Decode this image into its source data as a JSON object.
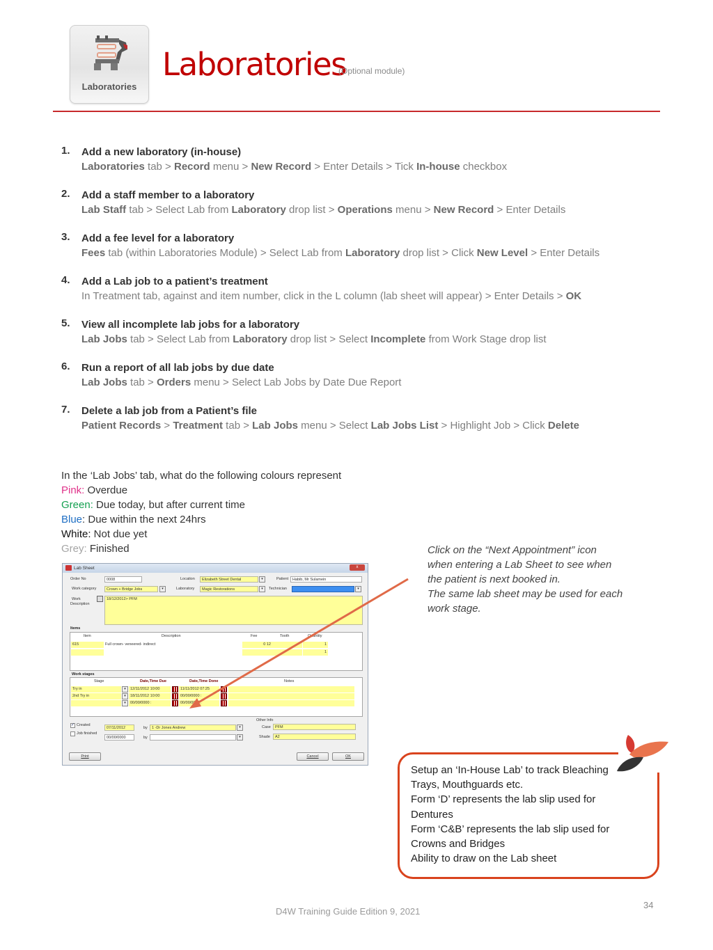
{
  "header": {
    "logo_label": "Laboratories",
    "title": "Laboratories",
    "subtitle": "(Optional module)",
    "accent_color": "#c00000"
  },
  "steps": [
    {
      "num": "1.",
      "title": "Add a new laboratory (in-house)",
      "path": [
        {
          "b": "Laboratories"
        },
        {
          "t": " tab > "
        },
        {
          "b": "Record"
        },
        {
          "t": " menu > "
        },
        {
          "b": "New Record"
        },
        {
          "t": " > Enter Details > Tick "
        },
        {
          "b": "In-house"
        },
        {
          "t": " checkbox"
        }
      ]
    },
    {
      "num": "2.",
      "title": "Add a staff member to a laboratory",
      "path": [
        {
          "b": "Lab Staff"
        },
        {
          "t": " tab > Select Lab from "
        },
        {
          "b": "Laboratory"
        },
        {
          "t": " drop list > "
        },
        {
          "b": "Operations"
        },
        {
          "t": " menu > "
        },
        {
          "b": "New Record"
        },
        {
          "t": " > Enter Details"
        }
      ]
    },
    {
      "num": "3.",
      "title": "Add a fee level for a laboratory",
      "path": [
        {
          "b": "Fees"
        },
        {
          "t": " tab (within Laboratories Module) > Select Lab from "
        },
        {
          "b": "Laboratory"
        },
        {
          "t": " drop list > Click "
        },
        {
          "b": "New Level"
        },
        {
          "t": " > Enter Details"
        }
      ]
    },
    {
      "num": "4.",
      "title": "Add a Lab job to a patient’s treatment",
      "path": [
        {
          "t": "In Treatment tab, against and item number, click in the L column (lab sheet will appear) > Enter Details > "
        },
        {
          "b": "OK"
        }
      ]
    },
    {
      "num": "5.",
      "title": "View all incomplete lab jobs for a laboratory",
      "path": [
        {
          "b": "Lab Jobs"
        },
        {
          "t": " tab > Select Lab from "
        },
        {
          "b": "Laboratory"
        },
        {
          "t": " drop list > Select "
        },
        {
          "b": "Incomplete"
        },
        {
          "t": " from Work Stage drop list"
        }
      ]
    },
    {
      "num": "6.",
      "title": "Run a report of all lab jobs by due date",
      "path": [
        {
          "b": "Lab Jobs"
        },
        {
          "t": " tab > "
        },
        {
          "b": "Orders"
        },
        {
          "t": " menu > Select Lab Jobs by Date Due Report"
        }
      ]
    },
    {
      "num": "7.",
      "title": "Delete a lab job from a Patient’s file",
      "path": [
        {
          "b": "Patient Records"
        },
        {
          "t": " > "
        },
        {
          "b": "Treatment"
        },
        {
          "t": " tab > "
        },
        {
          "b": "Lab Jobs"
        },
        {
          "t": " menu > Select "
        },
        {
          "b": "Lab Jobs List"
        },
        {
          "t": " > Highlight Job > Click "
        },
        {
          "b": "Delete"
        }
      ]
    }
  ],
  "legend": {
    "intro": "In the ‘Lab Jobs’ tab, what do the following colours represent",
    "items": [
      {
        "key": "Pink:",
        "value": " Overdue",
        "color": "#e0338a"
      },
      {
        "key": "Green:",
        "value": " Due today, but after current time",
        "color": "#14a050"
      },
      {
        "key": "Blue",
        "value": ": Due within the next 24hrs",
        "color": "#1f6fc4"
      },
      {
        "key": "White:",
        "value": " Not due yet",
        "color": "#111111"
      },
      {
        "key": "Grey:",
        "value": " Finished",
        "color": "#a5a5a5"
      }
    ]
  },
  "note": {
    "lines": [
      "Click on the “Next Appointment” icon",
      "when entering a Lab Sheet to see when",
      "the patient is next booked in.",
      "The same lab sheet may be used for each",
      "work stage."
    ]
  },
  "lab_sheet": {
    "title": "Lab Sheet",
    "close_label": "x",
    "order_no_label": "Order No",
    "order_no": "0008",
    "location_label": "Location",
    "location": "Elizabeth Street Dental",
    "patient_label": "Patient",
    "patient": "Habib, Mr Sulamein",
    "work_category_label": "Work category",
    "work_category": "Crown + Bridge Jobs",
    "laboratory_label": "Laboratory",
    "laboratory": "Magic Restorations",
    "technician_label": "Technician",
    "technician": "",
    "work_desc_label_1": "Work",
    "work_desc_label_2": "Description",
    "work_desc": "18/12/2012> PFM",
    "items_title": "Items",
    "items_columns": [
      "Item",
      "Description",
      "Fee",
      "Tooth",
      "Quantity"
    ],
    "items_rows": [
      {
        "item": "615",
        "description": "Full crown- veneered- indirect",
        "fee": "0 12",
        "tooth": "",
        "quantity": "1"
      },
      {
        "item": "",
        "description": "",
        "fee": "",
        "tooth": "",
        "quantity": "1"
      }
    ],
    "stages_title": "Work stages",
    "stages_columns": [
      "Stage",
      "Date,Time Due",
      "Date,Time Done",
      "Notes"
    ],
    "stages_rows": [
      {
        "stage": "Try in",
        "due": "12/11/2012  10:00",
        "done": "11/11/2012  07:25"
      },
      {
        "stage": "2nd Try in",
        "due": "18/11/2012  10:00",
        "done": "00/00/0000     :"
      },
      {
        "stage": "",
        "due": "00/00/0000     :",
        "done": "00/00/0000     :"
      }
    ],
    "created_label": "Created",
    "created_checked": true,
    "created_date": "07/11/2012",
    "created_by_label": "by",
    "created_by": "1 -Dr Jones Andrew",
    "finished_label": "Job finished",
    "finished_checked": false,
    "finished_date": "00/00/0000",
    "finished_by_label": "by",
    "finished_by": "",
    "other_info_label": "Other Info",
    "case_label": "Case",
    "case": "PFM",
    "shade_label": "Shade",
    "shade": "A2",
    "print_label": "Print",
    "cancel_label": "Cancel",
    "ok_label": "OK"
  },
  "callout": {
    "lines": [
      "Setup an ‘In-House Lab’ to track Bleaching",
      "Trays, Mouthguards etc.",
      "Form ‘D’ represents the lab slip used for",
      "Dentures",
      "Form ‘C&B’ represents the lab slip used for",
      "Crowns and Bridges",
      "Ability to draw on the Lab sheet"
    ],
    "border_color": "#d9431d"
  },
  "footer": {
    "text": "D4W Training Guide Edition 9, 2021",
    "page_number": "34"
  }
}
